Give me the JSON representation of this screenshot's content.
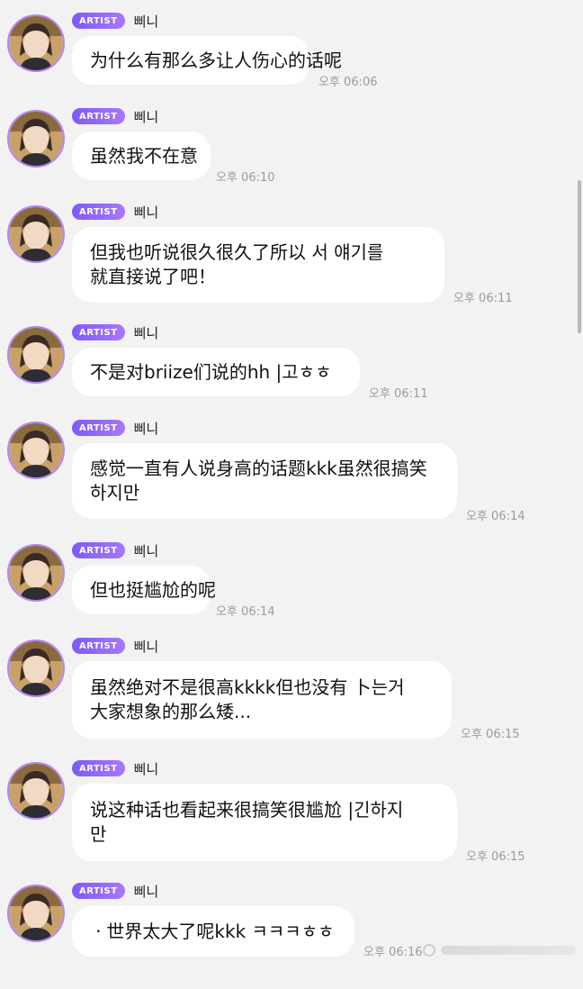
{
  "chat": {
    "messages": [
      {
        "badge": "ARTIST",
        "sender": "삐니",
        "text": "为什么有那么多让人伤心的话呢",
        "time": "오후 06:06"
      },
      {
        "badge": "ARTIST",
        "sender": "삐니",
        "text": "虽然我不在意",
        "time": "오후 06:10"
      },
      {
        "badge": "ARTIST",
        "sender": "삐니",
        "text": "但我也听说很久很久了所以 서 얘기를\n就直接说了吧！",
        "time": "오후 06:11"
      },
      {
        "badge": "ARTIST",
        "sender": "삐니",
        "text": "不是对briize们说的hh |고ㅎㅎ",
        "time": "오후 06:11"
      },
      {
        "badge": "ARTIST",
        "sender": "삐니",
        "text": "感觉一直有人说身高的话题kkk虽然很搞笑\n하지만",
        "time": "오후 06:14"
      },
      {
        "badge": "ARTIST",
        "sender": "삐니",
        "text": "但也挺尴尬的呢",
        "time": "오후 06:14"
      },
      {
        "badge": "ARTIST",
        "sender": "삐니",
        "text": "虽然绝对不是很高kkkk但也没有 卜는거\n大家想象的那么矮...",
        "time": "오후 06:15"
      },
      {
        "badge": "ARTIST",
        "sender": "삐니",
        "text": "说这种话也看起来很搞笑很尴尬 |긴하지\n만",
        "time": "오후 06:15"
      },
      {
        "badge": "ARTIST",
        "sender": "삐니",
        "text": "ㆍ世界太大了呢kkk ㅋㅋㅋㅎㅎ",
        "time": "오후 06:16"
      }
    ]
  },
  "colors": {
    "background": "#f2f2f3",
    "bubble": "#ffffff",
    "badge_start": "#7d5bf7",
    "badge_end": "#a878f8",
    "avatar_ring": "#b184f4",
    "time_text": "#9b9b9b"
  },
  "icons": {
    "avatar": "artist-profile-photo"
  }
}
